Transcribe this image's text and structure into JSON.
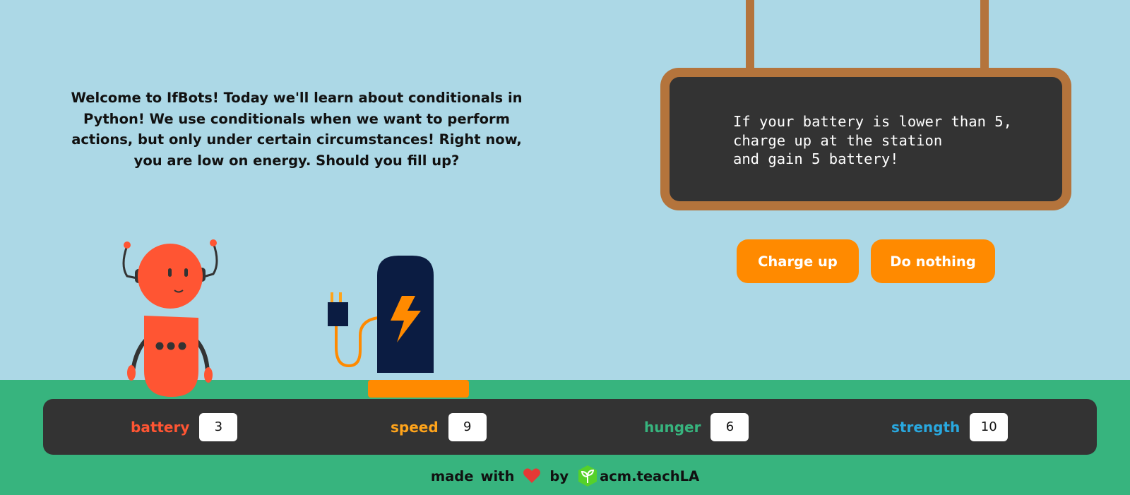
{
  "intro": {
    "text": "Welcome to IfBots! Today we'll learn about conditionals in Python! We use conditionals when we want to perform actions, but only under certain circumstances! Right now, you are low on energy. Should you fill up?"
  },
  "sign": {
    "lines": [
      "If your battery is lower than 5,",
      "charge up at the station",
      "and gain 5 battery!"
    ]
  },
  "actions": {
    "charge_label": "Charge up",
    "nothing_label": "Do nothing"
  },
  "stats": [
    {
      "label": "battery",
      "value": "3",
      "color": "#ff5533"
    },
    {
      "label": "speed",
      "value": "9",
      "color": "#ffa41b"
    },
    {
      "label": "hunger",
      "value": "6",
      "color": "#37b47e"
    },
    {
      "label": "strength",
      "value": "10",
      "color": "#29a8df"
    }
  ],
  "footer": {
    "made": "made",
    "with": "with",
    "by": "by",
    "brand": "acm.teachLA"
  },
  "icons": {
    "heart": "heart-icon",
    "brand": "leaf-logo-icon",
    "bolt": "lightning-bolt-icon",
    "plug": "plug-icon"
  },
  "colors": {
    "sky": "#acd8e6",
    "ground": "#37b47e",
    "panel": "#333333",
    "accent": "#ff8a00",
    "robot": "#ff5533",
    "station": "#0b1c42",
    "wood": "#b4743c"
  }
}
